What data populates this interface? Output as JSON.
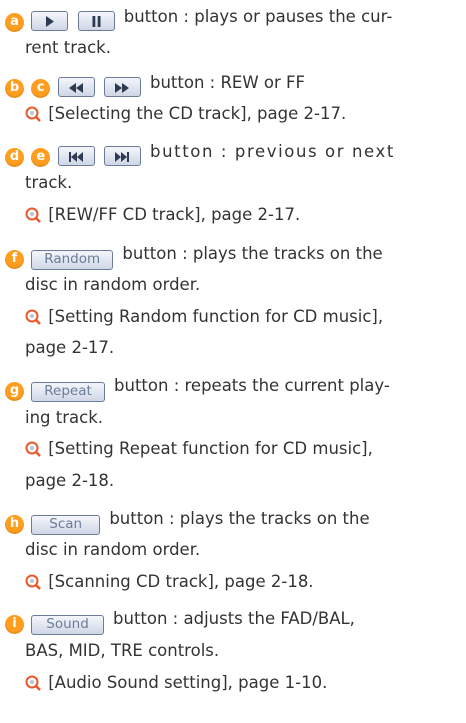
{
  "items": [
    {
      "badges": [
        "a"
      ],
      "buttons": [
        "play-icon",
        "pause-icon"
      ],
      "desc_line1": "button : plays or pauses the cur-",
      "desc_line2": "rent track."
    },
    {
      "badges": [
        "b",
        "c"
      ],
      "buttons": [
        "rewind-icon",
        "fast-forward-icon"
      ],
      "desc_line1": "button : REW or FF",
      "ref": "[Selecting the CD track], page 2-17."
    },
    {
      "badges": [
        "d",
        "e"
      ],
      "buttons": [
        "previous-track-icon",
        "next-track-icon"
      ],
      "desc_line1": "button : previous or next",
      "desc_line2": "track.",
      "ref": "[REW/FF CD track], page 2-17."
    },
    {
      "badges": [
        "f"
      ],
      "button_label": "Random",
      "desc_line1": "button : plays the tracks on the",
      "desc_line2": "disc in random order.",
      "ref_line1": "[Setting Random function for CD music],",
      "ref_line2": "page 2-17."
    },
    {
      "badges": [
        "g"
      ],
      "button_label": "Repeat",
      "desc_line1": "button : repeats the current play-",
      "desc_line2": "ing track.",
      "ref_line1": "[Setting Repeat function for CD music],",
      "ref_line2": "page 2-18."
    },
    {
      "badges": [
        "h"
      ],
      "button_label": "Scan",
      "desc_line1": "button : plays the tracks on the",
      "desc_line2": "disc in random order.",
      "ref": "[Scanning CD track], page 2-18."
    },
    {
      "badges": [
        "i"
      ],
      "button_label": "Sound",
      "desc_line1": "button : adjusts the FAD/BAL,",
      "desc_line2": "BAS, MID, TRE controls.",
      "ref": "[Audio Sound setting], page 1-10."
    }
  ],
  "colors": {
    "badge": "#ff9d1e",
    "text": "#333333",
    "key_border": "#6b7c9a",
    "magnifier": "#e9582a"
  }
}
